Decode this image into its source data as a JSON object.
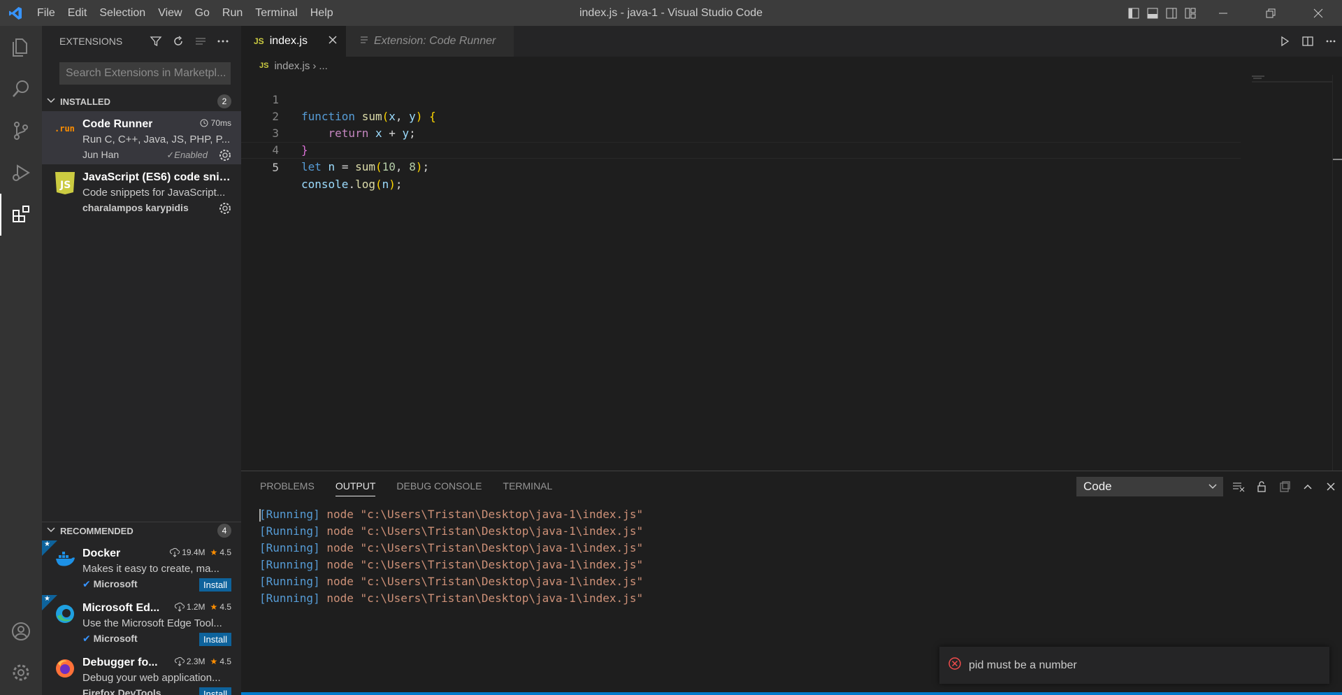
{
  "window": {
    "title": "index.js - java-1 - Visual Studio Code",
    "menu": [
      "File",
      "Edit",
      "Selection",
      "View",
      "Go",
      "Run",
      "Terminal",
      "Help"
    ]
  },
  "sidebar": {
    "title": "EXTENSIONS",
    "search_placeholder": "Search Extensions in Marketpl...",
    "installed": {
      "label": "INSTALLED",
      "count": "2",
      "items": [
        {
          "icon": "run-text",
          "name": "Code Runner",
          "meta": "70ms",
          "description": "Run C, C++, Java, JS, PHP, P...",
          "publisher": "Jun Han",
          "status": "✓Enabled"
        },
        {
          "icon": "js-logo",
          "name": "JavaScript (ES6) code snip...",
          "description": "Code snippets for JavaScript...",
          "publisher": "charalampos karypidis"
        }
      ]
    },
    "recommended": {
      "label": "RECOMMENDED",
      "count": "4",
      "items": [
        {
          "name": "Docker",
          "downloads": "19.4M",
          "rating": "4.5",
          "description": "Makes it easy to create, ma...",
          "publisher": "Microsoft",
          "install": "Install"
        },
        {
          "name": "Microsoft Ed...",
          "downloads": "1.2M",
          "rating": "4.5",
          "description": "Use the Microsoft Edge Tool...",
          "publisher": "Microsoft",
          "install": "Install"
        },
        {
          "name": "Debugger fo...",
          "downloads": "2.3M",
          "rating": "4.5",
          "description": "Debug your web application...",
          "publisher": "Firefox DevTools",
          "install": "Install"
        }
      ]
    }
  },
  "editor": {
    "tabs": [
      {
        "label": "index.js",
        "icon": "JS",
        "active": true
      },
      {
        "label": "Extension: Code Runner",
        "active": false
      }
    ],
    "breadcrumb": {
      "file": "index.js",
      "rest": "..."
    },
    "line_numbers": [
      "1",
      "2",
      "3",
      "4",
      "5"
    ],
    "code": [
      "function sum(x, y) {",
      "    return x + y;",
      "}",
      "let n = sum(10, 8);",
      "console.log(n);"
    ]
  },
  "panel": {
    "tabs": [
      "PROBLEMS",
      "OUTPUT",
      "DEBUG CONSOLE",
      "TERMINAL"
    ],
    "active_tab": "OUTPUT",
    "channel": "Code",
    "output_lines": [
      {
        "tag": "[Running]",
        "text": " node \"c:\\Users\\Tristan\\Desktop\\java-1\\index.js\""
      },
      {
        "tag": "[Running]",
        "text": " node \"c:\\Users\\Tristan\\Desktop\\java-1\\index.js\""
      },
      {
        "tag": "[Running]",
        "text": " node \"c:\\Users\\Tristan\\Desktop\\java-1\\index.js\""
      },
      {
        "tag": "[Running]",
        "text": " node \"c:\\Users\\Tristan\\Desktop\\java-1\\index.js\""
      },
      {
        "tag": "[Running]",
        "text": " node \"c:\\Users\\Tristan\\Desktop\\java-1\\index.js\""
      },
      {
        "tag": "[Running]",
        "text": " node \"c:\\Users\\Tristan\\Desktop\\java-1\\index.js\""
      }
    ]
  },
  "notification": {
    "message": "pid must be a number",
    "icon": "error-icon"
  },
  "colors": {
    "accent": "#007acc",
    "install": "#0e639c",
    "star": "#ff8e00",
    "error": "#f14c4c",
    "js_badge": "#cbcb41"
  }
}
